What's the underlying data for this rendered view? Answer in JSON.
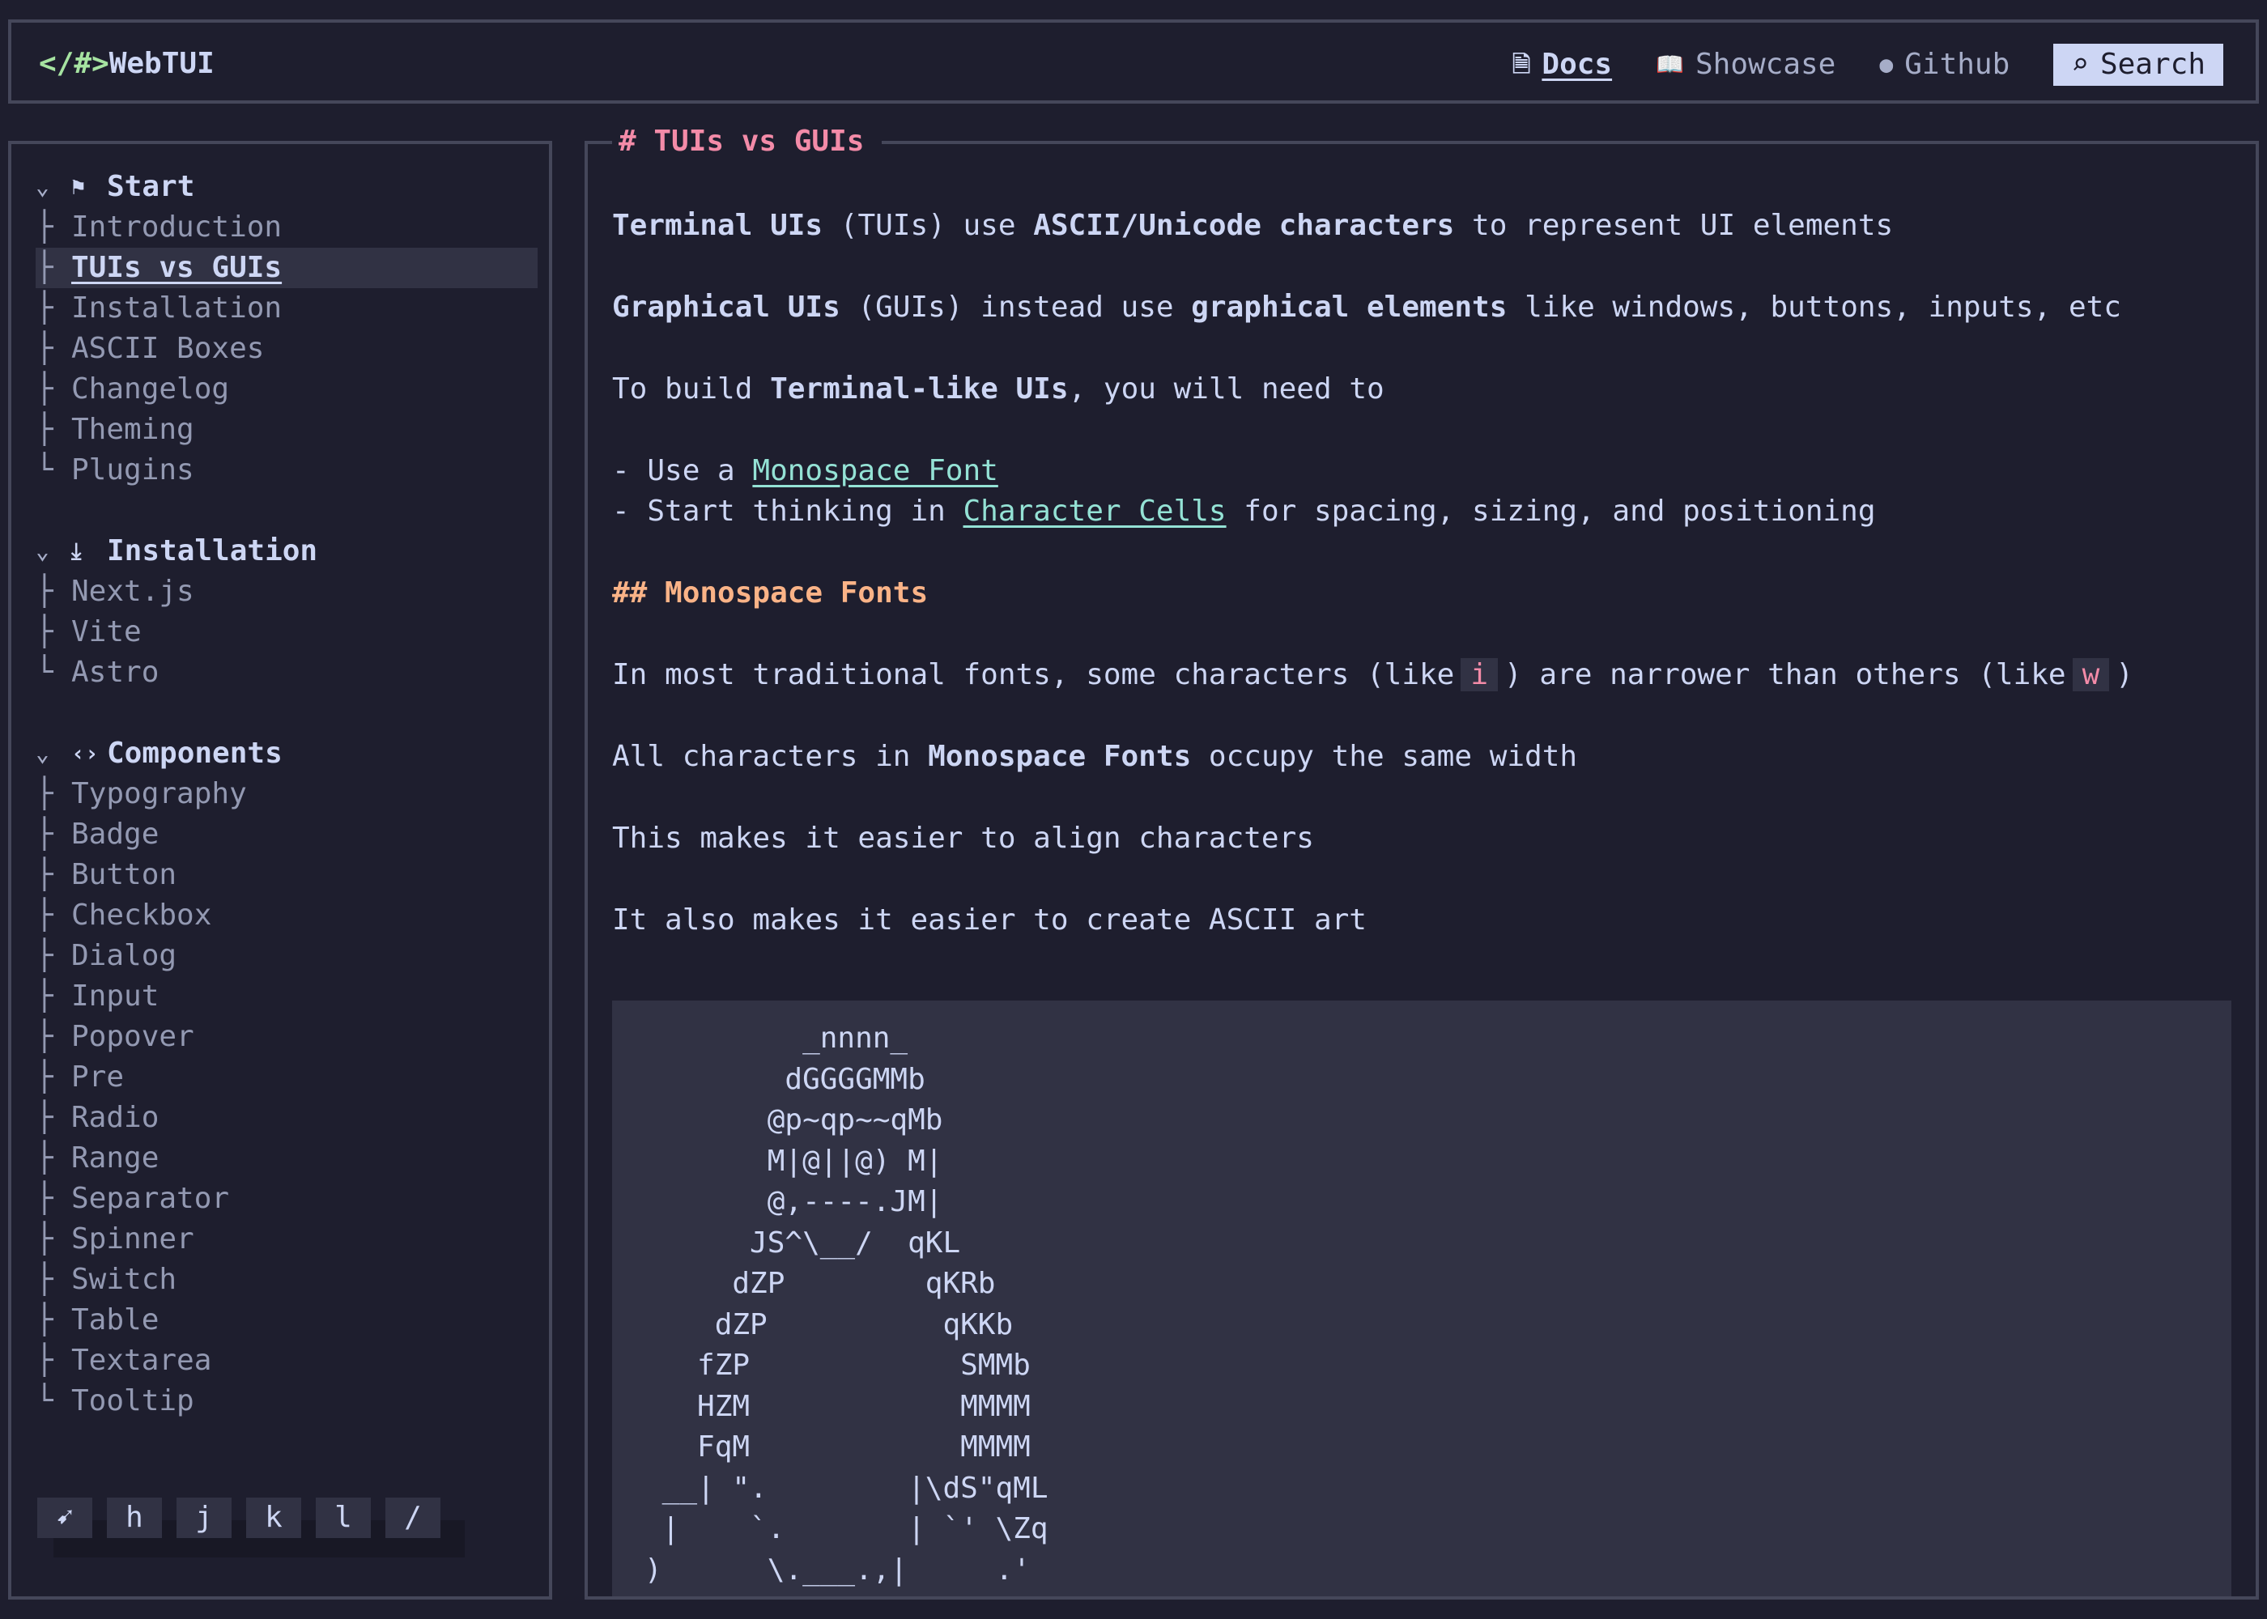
{
  "header": {
    "logo_prefix": "</#>",
    "logo_text": "WebTUI",
    "nav": [
      {
        "icon": "document-icon",
        "glyph": "🗎",
        "label": "Docs",
        "active": true
      },
      {
        "icon": "book-icon",
        "glyph": "📖",
        "label": "Showcase",
        "active": false
      },
      {
        "icon": "github-icon",
        "glyph": "●",
        "label": "Github",
        "active": false
      }
    ],
    "search": {
      "glyph": "⌕",
      "label": "Search"
    }
  },
  "sidebar": {
    "groups": [
      {
        "title": "Start",
        "icon": "flag-icon",
        "glyph": "⚑",
        "items": [
          {
            "branch": "├",
            "label": "Introduction"
          },
          {
            "branch": "├",
            "label": "TUIs vs GUIs",
            "active": true
          },
          {
            "branch": "├",
            "label": "Installation"
          },
          {
            "branch": "├",
            "label": "ASCII Boxes"
          },
          {
            "branch": "├",
            "label": "Changelog"
          },
          {
            "branch": "├",
            "label": "Theming"
          },
          {
            "branch": "└",
            "label": "Plugins"
          }
        ]
      },
      {
        "title": "Installation",
        "icon": "download-icon",
        "glyph": "⤓",
        "items": [
          {
            "branch": "├",
            "label": "Next.js"
          },
          {
            "branch": "├",
            "label": "Vite"
          },
          {
            "branch": "└",
            "label": "Astro"
          }
        ]
      },
      {
        "title": "Components",
        "icon": "code-icon",
        "glyph": "‹›",
        "items": [
          {
            "branch": "├",
            "label": "Typography"
          },
          {
            "branch": "├",
            "label": "Badge"
          },
          {
            "branch": "├",
            "label": "Button"
          },
          {
            "branch": "├",
            "label": "Checkbox"
          },
          {
            "branch": "├",
            "label": "Dialog"
          },
          {
            "branch": "├",
            "label": "Input"
          },
          {
            "branch": "├",
            "label": "Popover"
          },
          {
            "branch": "├",
            "label": "Pre"
          },
          {
            "branch": "├",
            "label": "Radio"
          },
          {
            "branch": "├",
            "label": "Range"
          },
          {
            "branch": "├",
            "label": "Separator"
          },
          {
            "branch": "├",
            "label": "Spinner"
          },
          {
            "branch": "├",
            "label": "Switch"
          },
          {
            "branch": "├",
            "label": "Table"
          },
          {
            "branch": "├",
            "label": "Textarea"
          },
          {
            "branch": "└",
            "label": "Tooltip"
          }
        ]
      }
    ],
    "keys": [
      "➹",
      "h",
      "j",
      "k",
      "l",
      "/"
    ]
  },
  "main": {
    "title": "# TUIs vs GUIs",
    "p1": {
      "a": "Terminal UIs",
      "b": " (TUIs) use ",
      "c": "ASCII/Unicode characters",
      "d": " to represent UI elements"
    },
    "p2": {
      "a": "Graphical UIs",
      "b": " (GUIs) instead use ",
      "c": "graphical elements",
      "d": " like windows, buttons, inputs, etc"
    },
    "p3": {
      "a": "To build ",
      "b": "Terminal-like UIs",
      "c": ", you will need to"
    },
    "li1": {
      "prefix": "- Use a ",
      "link": "Monospace Font"
    },
    "li2": {
      "prefix": "- Start thinking in ",
      "link": "Character Cells",
      "suffix": " for spacing, sizing, and positioning"
    },
    "h2": "## Monospace Fonts",
    "p4": {
      "a": "In most traditional fonts, some characters (like",
      "code1": "i",
      "b": ") are narrower than others (like",
      "code2": "w",
      "c": ")"
    },
    "p5": {
      "a": "All characters in ",
      "b": "Monospace Fonts",
      "c": " occupy the same width"
    },
    "p6": "This makes it easier to align characters",
    "p7": "It also makes it easier to create ASCII art",
    "ascii": "         _nnnn_\n        dGGGGMMb\n       @p~qp~~qMb\n       M|@||@) M|\n       @,----.JM|\n      JS^\\__/  qKL\n     dZP        qKRb\n    dZP          qKKb\n   fZP            SMMb\n   HZM            MMMM\n   FqM            MMMM\n __| \".        |\\dS\"qML\n |    `.       | `' \\Zq\n)      \\.___.,|     .'"
  }
}
